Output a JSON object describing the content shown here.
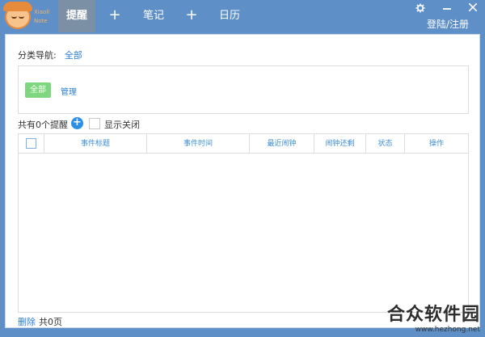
{
  "app": {
    "logo_text_1": "Xiaoli",
    "logo_text_2": "Note"
  },
  "tabs": [
    {
      "label": "提醒",
      "active": true
    },
    {
      "label": "笔记",
      "active": false
    },
    {
      "label": "日历",
      "active": false
    }
  ],
  "tab_plus": "+",
  "window": {
    "settings_icon": "gear-icon",
    "minimize_icon": "minimize-icon",
    "close_icon": "close-icon",
    "login_label": "登陆/注册"
  },
  "category_nav": {
    "label": "分类导航:",
    "current": "全部"
  },
  "filter": {
    "all_button": "全部",
    "manage_link": "管理"
  },
  "summary": {
    "count_text": "共有0个提醒",
    "show_closed_label": "显示关闭"
  },
  "table": {
    "columns": [
      "事件标题",
      "事件时间",
      "最近闹钟",
      "闹钟还剩",
      "状态",
      "操作"
    ]
  },
  "footer": {
    "delete_label": "删除",
    "pages_text": "共0页"
  },
  "watermark": {
    "title": "合众软件园",
    "url": "www.hezhong.net"
  },
  "colors": {
    "titlebar": "#5e8fc7",
    "active_tab": "#7b8fa5",
    "link": "#2a7ed1",
    "green_button": "#7ed77e"
  }
}
